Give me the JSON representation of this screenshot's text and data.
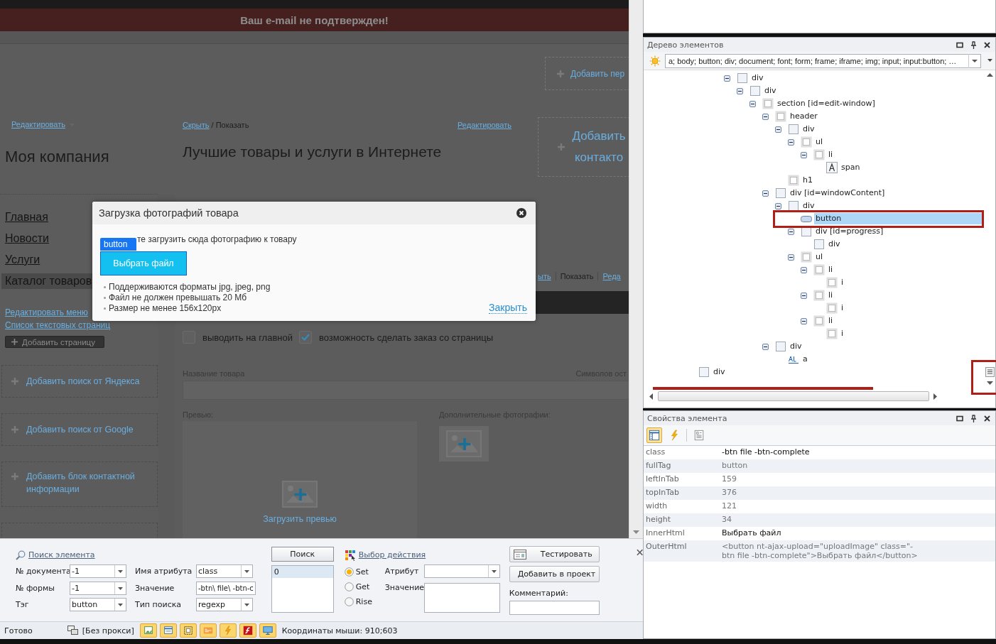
{
  "page": {
    "banner": "Ваш e-mail не подтвержден!",
    "company_edit_link": "Редактировать",
    "company": "Моя компания",
    "hide_link": "Скрыть",
    "separator": "/",
    "show": "Показать",
    "edit_link": "Редактировать",
    "heading": "Лучшие товары и услуги в Интернете",
    "side_boxes": [
      "Добавить пер",
      "Добавить контакто"
    ],
    "nav": [
      {
        "label": "Главная",
        "selected": false
      },
      {
        "label": "Новости",
        "selected": false
      },
      {
        "label": "Услуги",
        "selected": false
      },
      {
        "label": "Каталог товаров",
        "selected": true
      }
    ],
    "sidebar_links": [
      "Редактировать меню",
      "Список текстовых страниц"
    ],
    "add_page_button": "Добавить страницу",
    "widget_boxes": [
      "Добавить поиск от Яндекса",
      "Добавить поиск от Google",
      "Добавить блок контактной информации"
    ],
    "tab_links": [
      {
        "label": "ыть",
        "kind": "link"
      },
      {
        "label": "Показать",
        "kind": "text"
      },
      {
        "label": "Реда",
        "kind": "link"
      }
    ],
    "options": [
      {
        "label": "выводить на главной",
        "checked": false
      },
      {
        "label": "возможность сделать заказ со страницы",
        "checked": true
      }
    ],
    "name_label": "Название товара",
    "counter": "Символов ост",
    "preview_label": "Превью:",
    "upload_link": "Загрузить превью",
    "extra_photos_label": "Дополнительные фотографии:"
  },
  "dialog": {
    "title": "Загрузка фотографий товара",
    "intro": "те загрузить сюда фотографию к товару",
    "inspector_tag": "button",
    "choose_button": "Выбрать файл",
    "notes": [
      "Поддерживаются форматы jpg, jpeg, png",
      "Файл не должен превышать 20 Мб",
      "Размер не менее 156x120px"
    ],
    "close_link": "Закрыть"
  },
  "search_panel": {
    "title_link": "Поиск элемента",
    "fields": [
      {
        "label": "№ документа",
        "value": "-1",
        "kind": "combo"
      },
      {
        "label": "№ формы",
        "value": "-1",
        "kind": "combo"
      },
      {
        "label": "Тэг",
        "value": "button",
        "kind": "combo"
      }
    ],
    "attr_fields": [
      {
        "label": "Имя атрибута",
        "value": "class",
        "kind": "combo"
      },
      {
        "label": "Значение",
        "value": "-btn\\ file\\ -btn-c",
        "kind": "text"
      },
      {
        "label": "Тип поиска",
        "value": "regexp",
        "kind": "combo"
      }
    ],
    "search_button": "Поиск",
    "results": [
      {
        "label": "0",
        "selected": true
      }
    ],
    "action_link": "Выбор действия",
    "actions": [
      {
        "label": "Set",
        "selected": true
      },
      {
        "label": "Get",
        "selected": false
      },
      {
        "label": "Rise",
        "selected": false
      }
    ],
    "attribute_label": "Атрибут",
    "value_label": "Значение",
    "test_button": "Тестировать",
    "add_button": "Добавить в проект",
    "comment_label": "Комментарий:"
  },
  "status_bar": {
    "status": "Готово",
    "proxy": "[Без прокси]",
    "tools": [
      {
        "kind": "image",
        "on": true
      },
      {
        "kind": "window",
        "on": true
      },
      {
        "kind": "frame",
        "on": true
      },
      {
        "kind": "css",
        "on": true
      },
      {
        "kind": "lightning",
        "on": true
      },
      {
        "kind": "flash",
        "on": true
      },
      {
        "kind": "monitor",
        "on": true
      }
    ],
    "coords": "Координаты мыши: 910;603"
  },
  "element_tree": {
    "title": "Дерево элементов",
    "filter": "a; body; button; div; document; font; form; frame; iframe; img; input; input:button; …",
    "nodes": [
      {
        "children": [
          {
            "children": [
              {
                "children": [
                  {
                    "label": "div",
                    "kind": "element",
                    "expanded": true,
                    "selected": false,
                    "children": [
                      {
                        "label": "div",
                        "kind": "element",
                        "expanded": true,
                        "selected": false,
                        "children": [
                          {
                            "label": "section [id=edit-window]",
                            "kind": "container",
                            "expanded": true,
                            "selected": false,
                            "children": [
                              {
                                "label": "header",
                                "kind": "container",
                                "expanded": true,
                                "selected": false,
                                "children": [
                                  {
                                    "label": "div",
                                    "kind": "element",
                                    "expanded": true,
                                    "selected": false,
                                    "children": [
                                      {
                                        "label": "ul",
                                        "kind": "container",
                                        "expanded": true,
                                        "selected": false,
                                        "children": [
                                          {
                                            "label": "li",
                                            "kind": "container",
                                            "expanded": true,
                                            "selected": false,
                                            "children": [
                                              {
                                                "label": "span",
                                                "kind": "text",
                                                "selected": false
                                              }
                                            ]
                                          }
                                        ]
                                      }
                                    ]
                                  },
                                  {
                                    "label": "h1",
                                    "kind": "container",
                                    "selected": false
                                  }
                                ]
                              },
                              {
                                "label": "div [id=windowContent]",
                                "kind": "element",
                                "expanded": true,
                                "selected": false,
                                "children": [
                                  {
                                    "label": "div",
                                    "kind": "element",
                                    "expanded": true,
                                    "selected": false,
                                    "children": [
                                      {
                                        "label": "button",
                                        "kind": "button",
                                        "selected": true
                                      },
                                      {
                                        "label": "div [id=progress]",
                                        "kind": "element",
                                        "expanded": true,
                                        "selected": false,
                                        "children": [
                                          {
                                            "label": "div",
                                            "kind": "element",
                                            "selected": false
                                          }
                                        ]
                                      },
                                      {
                                        "label": "ul",
                                        "kind": "container",
                                        "expanded": true,
                                        "selected": false,
                                        "children": [
                                          {
                                            "label": "li",
                                            "kind": "container",
                                            "expanded": true,
                                            "selected": false,
                                            "children": [
                                              {
                                                "label": "i",
                                                "kind": "container",
                                                "selected": false
                                              }
                                            ]
                                          },
                                          {
                                            "label": "li",
                                            "kind": "container",
                                            "expanded": true,
                                            "selected": false,
                                            "children": [
                                              {
                                                "label": "i",
                                                "kind": "container",
                                                "selected": false
                                              }
                                            ]
                                          },
                                          {
                                            "label": "li",
                                            "kind": "container",
                                            "expanded": true,
                                            "selected": false,
                                            "children": [
                                              {
                                                "label": "i",
                                                "kind": "container",
                                                "selected": false
                                              }
                                            ]
                                          }
                                        ]
                                      }
                                    ]
                                  }
                                ]
                              },
                              {
                                "label": "div",
                                "kind": "element",
                                "expanded": true,
                                "selected": false,
                                "children": [
                                  {
                                    "label": "a",
                                    "kind": "link",
                                    "selected": false
                                  }
                                ]
                              }
                            ]
                          }
                        ]
                      }
                    ]
                  }
                ]
              }
            ]
          }
        ]
      },
      {
        "label": "div",
        "kind": "element",
        "selected": false
      }
    ]
  },
  "properties": {
    "title": "Свойства элемента",
    "tools": [
      {
        "kind": "categorized",
        "selected": true
      },
      {
        "kind": "events",
        "selected": false
      },
      {
        "kind": "pages",
        "selected": false
      }
    ],
    "rows": [
      {
        "name": "class",
        "value": "-btn file -btn-complete",
        "emphasized": true
      },
      {
        "name": "fullTag",
        "value": "button",
        "emphasized": false
      },
      {
        "name": "leftInTab",
        "value": "159",
        "emphasized": false
      },
      {
        "name": "topInTab",
        "value": "376",
        "emphasized": false
      },
      {
        "name": "width",
        "value": "121",
        "emphasized": false
      },
      {
        "name": "height",
        "value": "34",
        "emphasized": false
      },
      {
        "name": "InnerHtml",
        "value": "Выбрать файл",
        "emphasized": true
      },
      {
        "name": "OuterHtml",
        "value": "<button nt-ajax-upload=\"uploadImage\" class=\"-btn file -btn-complete\">Выбрать файл</button>",
        "emphasized": false
      }
    ]
  }
}
